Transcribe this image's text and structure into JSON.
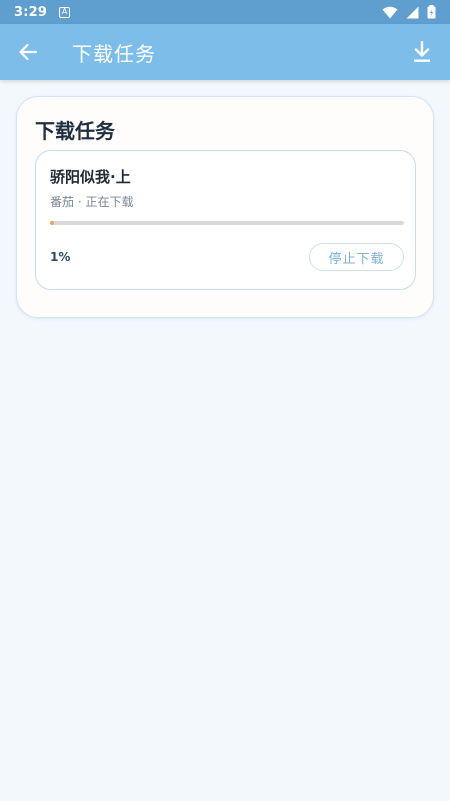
{
  "status_bar": {
    "time": "3:29",
    "notification_letter": "A"
  },
  "app_bar": {
    "title": "下载任务",
    "back_icon": "arrow-left-icon",
    "action_icon": "download-icon"
  },
  "section": {
    "title": "下载任务"
  },
  "tasks": [
    {
      "name": "骄阳似我·上",
      "subtitle": "番茄 · 正在下载",
      "progress": 0.01,
      "percent_label": "1%",
      "stop_label": "停止下载"
    }
  ],
  "colors": {
    "status_bar": "#5f9fd0",
    "app_bar": "#7dbde9",
    "background": "#f3f8fd",
    "progress": "#f0a14a",
    "accent_text": "#7ab1d9"
  }
}
